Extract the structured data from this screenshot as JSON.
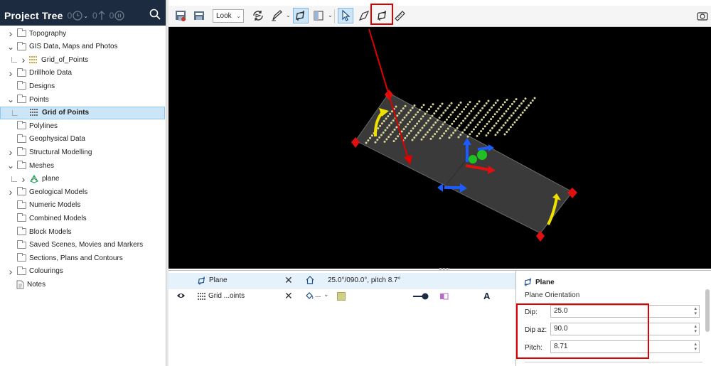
{
  "project_tree": {
    "title": "Project Tree",
    "controls": [
      {
        "count": "0",
        "icon": "clock-icon"
      },
      {
        "count": "0",
        "icon": "arrow-up-icon"
      },
      {
        "count": "0",
        "icon": "pause-icon"
      }
    ],
    "items": [
      {
        "label": "Topography",
        "expander": "collapsed",
        "icon": "folder-icon"
      },
      {
        "label": "GIS Data, Maps and Photos",
        "expander": "expanded",
        "icon": "folder-icon"
      },
      {
        "label": "Grid_of_Points",
        "expander": "collapsed",
        "icon": "grid-points-icon",
        "child": true
      },
      {
        "label": "Drillhole Data",
        "expander": "collapsed",
        "icon": "folder-icon"
      },
      {
        "label": "Designs",
        "expander": "none",
        "icon": "folder-icon"
      },
      {
        "label": "Points",
        "expander": "expanded",
        "icon": "folder-icon"
      },
      {
        "label": "Grid of Points",
        "expander": "none",
        "icon": "point-grid-icon",
        "child": true,
        "selected": true
      },
      {
        "label": "Polylines",
        "expander": "none",
        "icon": "folder-icon"
      },
      {
        "label": "Geophysical Data",
        "expander": "none",
        "icon": "folder-icon"
      },
      {
        "label": "Structural Modelling",
        "expander": "collapsed",
        "icon": "folder-icon"
      },
      {
        "label": "Meshes",
        "expander": "expanded",
        "icon": "folder-icon"
      },
      {
        "label": "plane",
        "expander": "collapsed",
        "icon": "mesh-icon",
        "child": true
      },
      {
        "label": "Geological Models",
        "expander": "collapsed",
        "icon": "folder-icon"
      },
      {
        "label": "Numeric Models",
        "expander": "none",
        "icon": "folder-icon"
      },
      {
        "label": "Combined Models",
        "expander": "none",
        "icon": "folder-icon"
      },
      {
        "label": "Block Models",
        "expander": "none",
        "icon": "folder-icon"
      },
      {
        "label": "Saved Scenes, Movies and Markers",
        "expander": "none",
        "icon": "folder-icon"
      },
      {
        "label": "Sections, Plans and Contours",
        "expander": "none",
        "icon": "folder-icon"
      },
      {
        "label": "Colourings",
        "expander": "collapsed",
        "icon": "folder-icon"
      },
      {
        "label": "Notes",
        "expander": "none",
        "icon": "document-icon"
      }
    ]
  },
  "toolbar": {
    "look_label": "Look",
    "active_tool": "plane-tool",
    "highlighted_tool": "move-plane-tool"
  },
  "object_list": {
    "rows": [
      {
        "name": "Plane",
        "orientation": "25.0°/090.0°, pitch 8.7°"
      },
      {
        "name": "Grid ...oints",
        "colour_menu": "..."
      }
    ],
    "swatch_color": "#d4cf87"
  },
  "properties": {
    "title": "Plane",
    "subtitle": "Plane Orientation",
    "fields": [
      {
        "label": "Dip:",
        "value": "25.0"
      },
      {
        "label": "Dip az:",
        "value": "90.0"
      },
      {
        "label": "Pitch:",
        "value": "8.71"
      }
    ]
  },
  "colors": {
    "annotation": "#e00000",
    "handle_red": "#e01010",
    "handle_yellow": "#f0e000",
    "handle_blue": "#1a5cff",
    "handle_green": "#21c021",
    "points": "#d8d49a"
  }
}
